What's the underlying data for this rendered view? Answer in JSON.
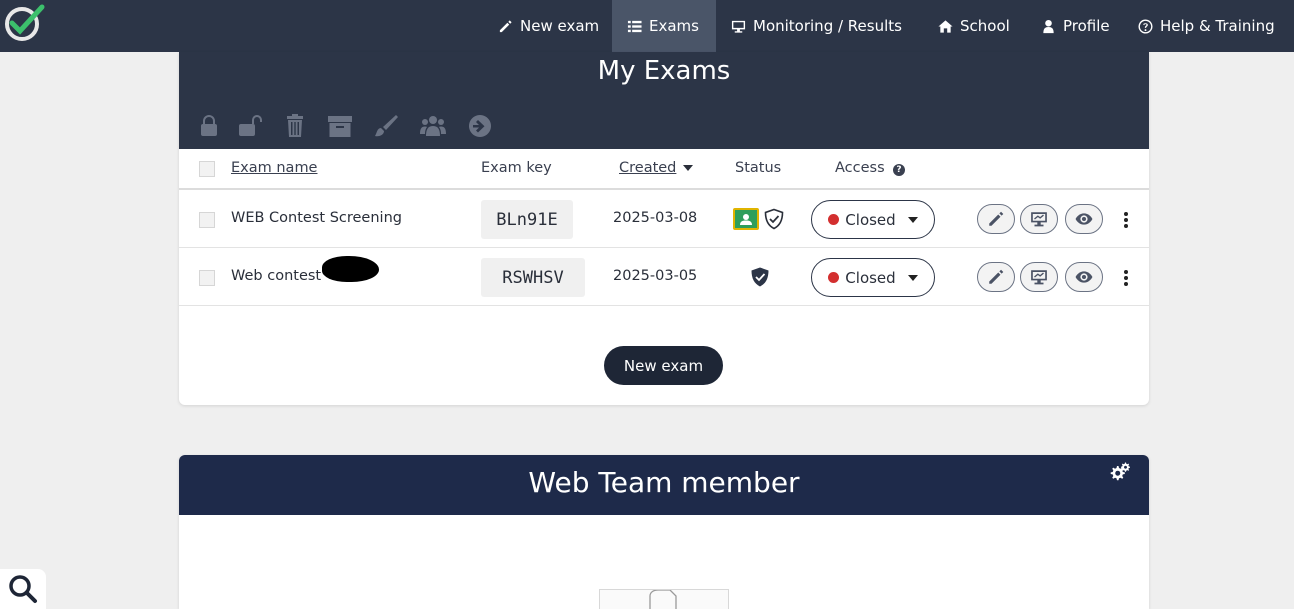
{
  "nav": {
    "items": [
      {
        "label": "New exam",
        "icon": "pencil-icon"
      },
      {
        "label": "Exams",
        "icon": "list-icon"
      },
      {
        "label": "Monitoring / Results",
        "icon": "monitor-icon"
      },
      {
        "label": "School",
        "icon": "home-icon"
      },
      {
        "label": "Profile",
        "icon": "user-icon"
      },
      {
        "label": "Help & Training",
        "icon": "question-circle-icon"
      }
    ],
    "active": "Exams"
  },
  "exams": {
    "title": "My Exams",
    "columns": {
      "name": "Exam name",
      "key": "Exam key",
      "created": "Created",
      "status": "Status",
      "access": "Access"
    },
    "rows": [
      {
        "name": "WEB Contest Screening",
        "key": "BLn91E",
        "created": "2025-03-08",
        "access": "Closed"
      },
      {
        "name": "Web contest",
        "key": "RSWHSV",
        "created": "2025-03-05",
        "access": "Closed"
      }
    ],
    "new_exam_button": "New exam"
  },
  "team": {
    "title": "Web Team member"
  },
  "colors": {
    "nav_bg": "#2c3547",
    "team_header": "#1e2a4a",
    "closed_dot": "#d32f2f",
    "accent_green": "#2e9e5b"
  }
}
